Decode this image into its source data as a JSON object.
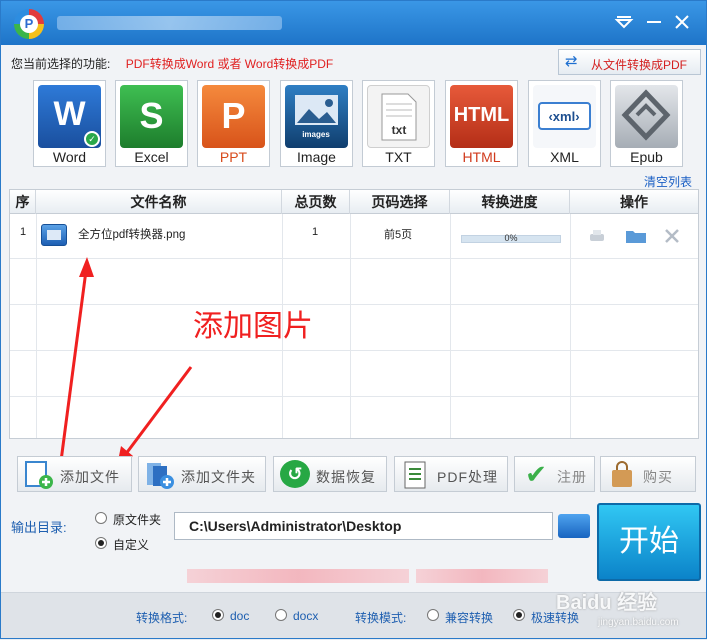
{
  "window": {
    "min_icon": "minimize-icon",
    "collapse_icon": "collapse-icon",
    "close_icon": "close-icon"
  },
  "function_bar": {
    "label": "您当前选择的功能:",
    "value": "PDF转换成Word 或者 Word转换成PDF",
    "switch_button": "从文件转换成PDF"
  },
  "formats": [
    {
      "label": "Word",
      "icon": "W",
      "color": "#1f5db8"
    },
    {
      "label": "Excel",
      "icon": "S",
      "color": "#2a9a3a"
    },
    {
      "label": "PPT",
      "icon": "P",
      "color": "#e5671f"
    },
    {
      "label": "Image",
      "icon": "images",
      "color": "#1a5c96"
    },
    {
      "label": "TXT",
      "icon": "txt",
      "color": "#e8e8e8"
    },
    {
      "label": "HTML",
      "icon": "HTML",
      "color": "#d9472b"
    },
    {
      "label": "XML",
      "icon": "xml",
      "color": "#eef2f6"
    },
    {
      "label": "Epub",
      "icon": "e",
      "color": "#a9b0b8"
    }
  ],
  "clear_list": "清空列表",
  "table": {
    "headers": [
      "序",
      "文件名称",
      "总页数",
      "页码选择",
      "转换进度",
      "操作"
    ],
    "rows": [
      {
        "index": "1",
        "name": "全方位pdf转换器.png",
        "pages": "1",
        "page_select": "前5页",
        "progress": "0%",
        "progress_value": 0
      }
    ]
  },
  "annotation": "添加图片",
  "actions": [
    {
      "label": "添加文件",
      "icon": "add-file-icon",
      "color": "#4aa0e0"
    },
    {
      "label": "添加文件夹",
      "icon": "add-folder-icon",
      "color": "#3b7fd1"
    },
    {
      "label": "数据恢复",
      "icon": "restore-icon",
      "color": "#27a844"
    },
    {
      "label": "PDF处理",
      "icon": "pdf-process-icon",
      "color": "#3a8a3a"
    },
    {
      "label": "注册",
      "icon": "check-icon",
      "color": "#3bb04a"
    },
    {
      "label": "购买",
      "icon": "shopping-bag-icon",
      "color": "#c98a45"
    }
  ],
  "output": {
    "label": "输出目录:",
    "option_source": "原文件夹",
    "option_custom": "自定义",
    "selected": "自定义",
    "path": "C:\\Users\\Administrator\\Desktop"
  },
  "start_button": "开始",
  "bottom": {
    "format_label": "转换格式:",
    "format_options": [
      "doc",
      "docx"
    ],
    "format_selected": "doc",
    "mode_label": "转换模式:",
    "mode_options": [
      "兼容转换",
      "极速转换"
    ],
    "mode_selected": "极速转换"
  },
  "watermark": {
    "main": "Baidu 经验",
    "sub": "jingyan.baidu.com"
  }
}
